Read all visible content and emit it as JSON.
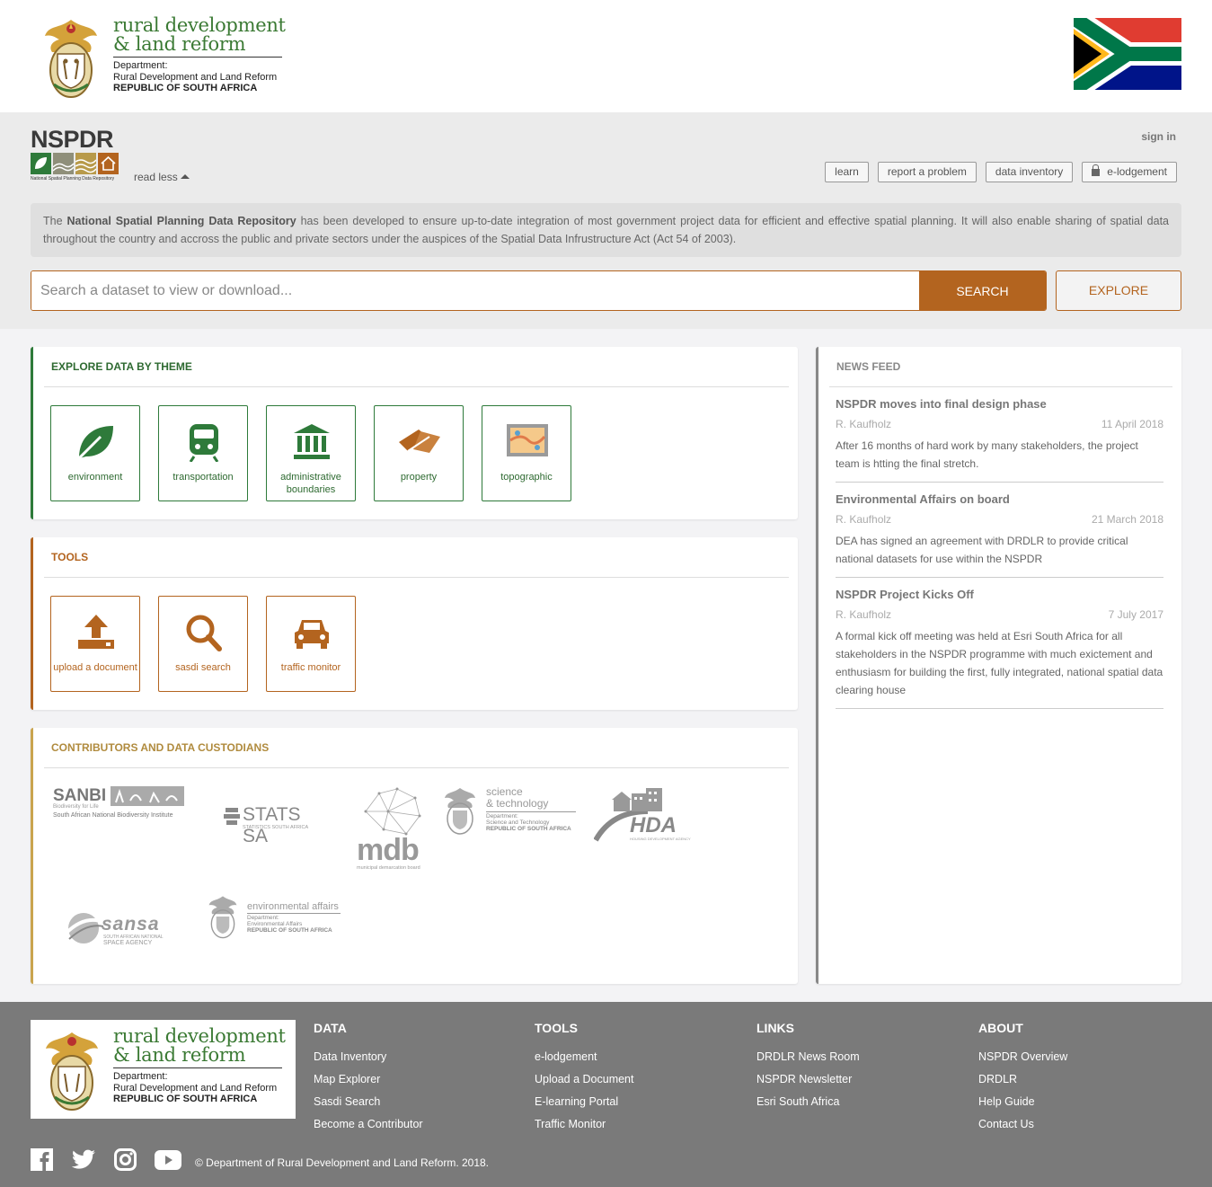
{
  "header": {
    "dept_name_line1": "rural development",
    "dept_name_line2": "& land reform",
    "dept_sub1": "Department:",
    "dept_sub2": "Rural Development and Land Reform",
    "dept_sub3": "REPUBLIC OF SOUTH AFRICA"
  },
  "band": {
    "logo_title": "NSPDR",
    "logo_caption": "National Spatial Planning Data Repository",
    "read_less": "read less",
    "sign_in": "sign in",
    "quick_links": [
      "learn",
      "report a problem",
      "data inventory",
      "e-lodgement"
    ],
    "intro_prefix": "The ",
    "intro_bold": "National Spatial Planning Data Repository",
    "intro_rest": " has been developed to ensure up-to-date integration of most government project data for efficient and effective spatial planning. It will also enable sharing of spatial data throughout the country and accross the public and private sectors under the auspices of the Spatial Data Infrustructure Act (Act 54 of 2003).",
    "search_placeholder": "Search a dataset to view or download...",
    "search_label": "SEARCH",
    "explore_label": "EXPLORE"
  },
  "themes": {
    "heading": "EXPLORE DATA BY THEME",
    "items": [
      "environment",
      "transportation",
      "administrative boundaries",
      "property",
      "topographic"
    ]
  },
  "tools": {
    "heading": "TOOLS",
    "items": [
      "upload a document",
      "sasdi search",
      "traffic monitor"
    ]
  },
  "contributors": {
    "heading": "CONTRIBUTORS AND DATA CUSTODIANS",
    "sanbi": "SANBI",
    "sanbi_tag": "Biodiversity for Life",
    "sanbi_sub": "South African National Biodiversity Institute",
    "statssa": "STATS SA",
    "statssa_sub": "STATISTICS SOUTH AFRICA",
    "mdb": "mdb",
    "mdb_sub": "municipal demarcation board",
    "dst_1": "science",
    "dst_2": "& technology",
    "dst_3": "Department:",
    "dst_4": "Science and Technology",
    "dst_5": "REPUBLIC OF SOUTH AFRICA",
    "hda": "HDA",
    "hda_sub": "HOUSING DEVELOPMENT AGENCY",
    "sansa": "sansa",
    "sansa_sub1": "SOUTH AFRICAN NATIONAL",
    "sansa_sub2": "SPACE AGENCY",
    "dea_1": "environmental affairs",
    "dea_2": "Department:",
    "dea_3": "Environmental Affairs",
    "dea_4": "REPUBLIC OF SOUTH AFRICA"
  },
  "news": {
    "heading": "NEWS FEED",
    "items": [
      {
        "title": "NSPDR moves into final design phase",
        "author": "R. Kaufholz",
        "date": "11 April 2018",
        "body": "After 16 months of hard work by many stakeholders, the project team is htting the final stretch."
      },
      {
        "title": "Environmental Affairs on board",
        "author": "R. Kaufholz",
        "date": "21 March 2018",
        "body": "DEA has signed an agreement with DRDLR to provide critical national datasets for use within the NSPDR"
      },
      {
        "title": "NSPDR Project Kicks Off",
        "author": "R. Kaufholz",
        "date": "7 July 2017",
        "body": "A formal kick off meeting was held at Esri South Africa for all stakeholders in the NSPDR programme with much exictement and enthusiasm for building the first, fully integrated, national spatial data clearing house"
      }
    ]
  },
  "footer": {
    "columns": [
      {
        "heading": "DATA",
        "links": [
          "Data Inventory",
          "Map Explorer",
          "Sasdi Search",
          "Become a Contributor"
        ]
      },
      {
        "heading": "TOOLS",
        "links": [
          "e-lodgement",
          "Upload a Document",
          "E-learning Portal",
          "Traffic Monitor"
        ]
      },
      {
        "heading": "LINKS",
        "links": [
          "DRDLR News Room",
          "NSPDR Newsletter",
          "Esri South Africa"
        ]
      },
      {
        "heading": "ABOUT",
        "links": [
          "NSPDR Overview",
          "DRDLR",
          "Help Guide",
          "Contact Us"
        ]
      }
    ],
    "copyright": "© Department of Rural Development and Land Reform. 2018."
  },
  "colors": {
    "brand_green": "#2e7a3a",
    "brand_orange": "#b3641f",
    "brand_gold": "#c9a44e",
    "footer_grey": "#7a7a7a"
  },
  "icons": [
    "facebook-icon",
    "twitter-icon",
    "instagram-icon",
    "youtube-icon",
    "leaf-icon",
    "train-icon",
    "institution-icon",
    "parcel-icon",
    "map-icon",
    "upload-icon",
    "search-icon",
    "car-icon",
    "lock-icon"
  ]
}
